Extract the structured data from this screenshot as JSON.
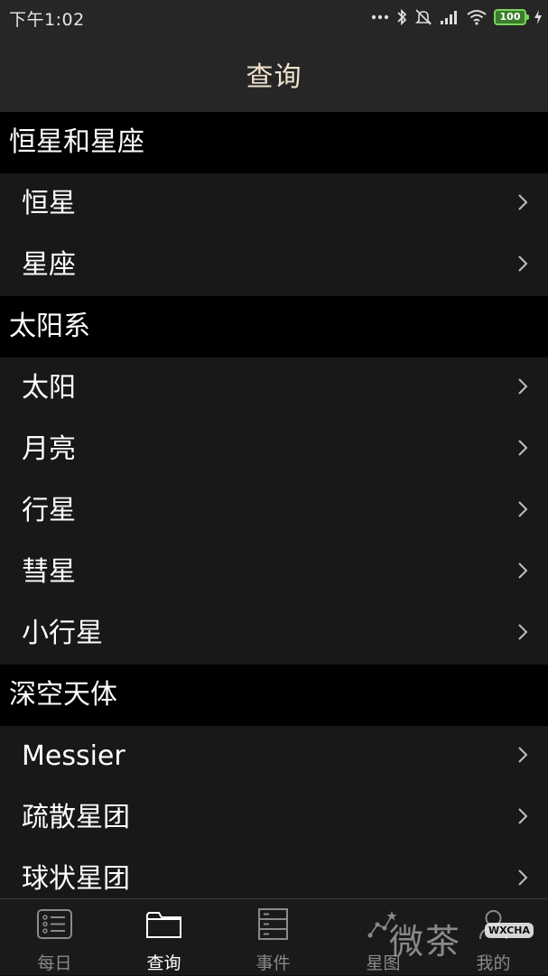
{
  "status_bar": {
    "time": "下午1:02",
    "battery": "100",
    "icons": [
      "more-dots-icon",
      "bluetooth-icon",
      "mute-icon",
      "signal-icon",
      "wifi-icon",
      "battery-icon",
      "charging-icon"
    ]
  },
  "header": {
    "title": "查询"
  },
  "sections": [
    {
      "title": "恒星和星座",
      "items": [
        "恒星",
        "星座"
      ]
    },
    {
      "title": "太阳系",
      "items": [
        "太阳",
        "月亮",
        "行星",
        "彗星",
        "小行星"
      ]
    },
    {
      "title": "深空天体",
      "items": [
        "Messier",
        "疏散星团",
        "球状星团"
      ]
    }
  ],
  "tabs": [
    {
      "label": "每日",
      "icon": "daily-list-icon",
      "active": false
    },
    {
      "label": "查询",
      "icon": "folder-icon",
      "active": true
    },
    {
      "label": "事件",
      "icon": "events-icon",
      "active": false
    },
    {
      "label": "星图",
      "icon": "star-map-icon",
      "active": false
    },
    {
      "label": "我的",
      "icon": "profile-icon",
      "active": false
    }
  ],
  "watermark": {
    "text": "微茶",
    "badge": "WXCHA"
  },
  "colors": {
    "header_bg": "#262626",
    "title": "#efe3cf",
    "section_bg": "#000000",
    "row_bg": "#181818",
    "tab_active": "#ffffff",
    "tab_inactive": "#8a8a8a"
  }
}
